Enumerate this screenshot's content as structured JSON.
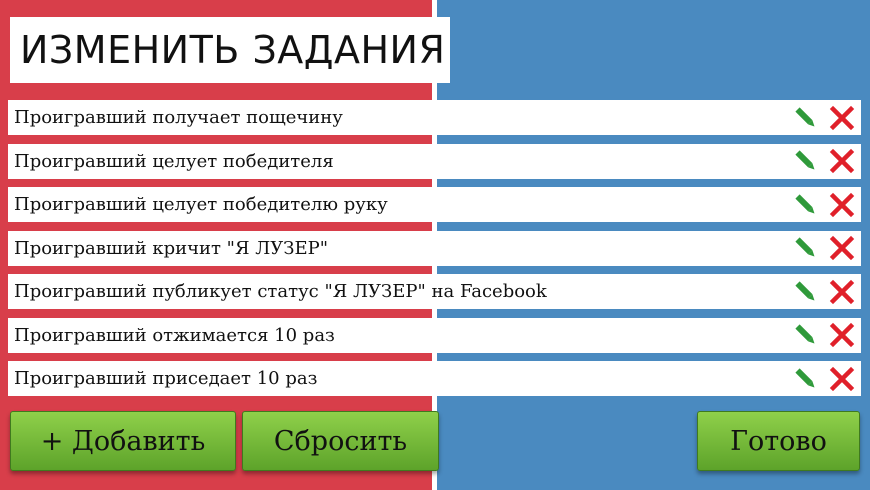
{
  "header": {
    "title": "ИЗМЕНИТЬ ЗАДАНИЯ"
  },
  "tasks": [
    {
      "text": "Проигравший получает пощечину"
    },
    {
      "text": "Проигравший целует победителя"
    },
    {
      "text": "Проигравший целует победителю руку"
    },
    {
      "text": "Проигравший кричит \"Я ЛУЗЕР\""
    },
    {
      "text": "Проигравший публикует статус \"Я ЛУЗЕР\" на Facebook"
    },
    {
      "text": "Проигравший отжимается 10 раз"
    },
    {
      "text": "Проигравший приседает 10 раз"
    }
  ],
  "actions": {
    "edit_icon": "pencil-icon",
    "delete_icon": "close-icon"
  },
  "buttons": {
    "add": "+ Добавить",
    "reset": "Сбросить",
    "done": "Готово"
  },
  "colors": {
    "left_panel": "#d83e4a",
    "right_panel": "#4a8ac0",
    "button_green": "#72b83a",
    "edit_green": "#2f9a3a",
    "delete_red": "#e0202a"
  }
}
